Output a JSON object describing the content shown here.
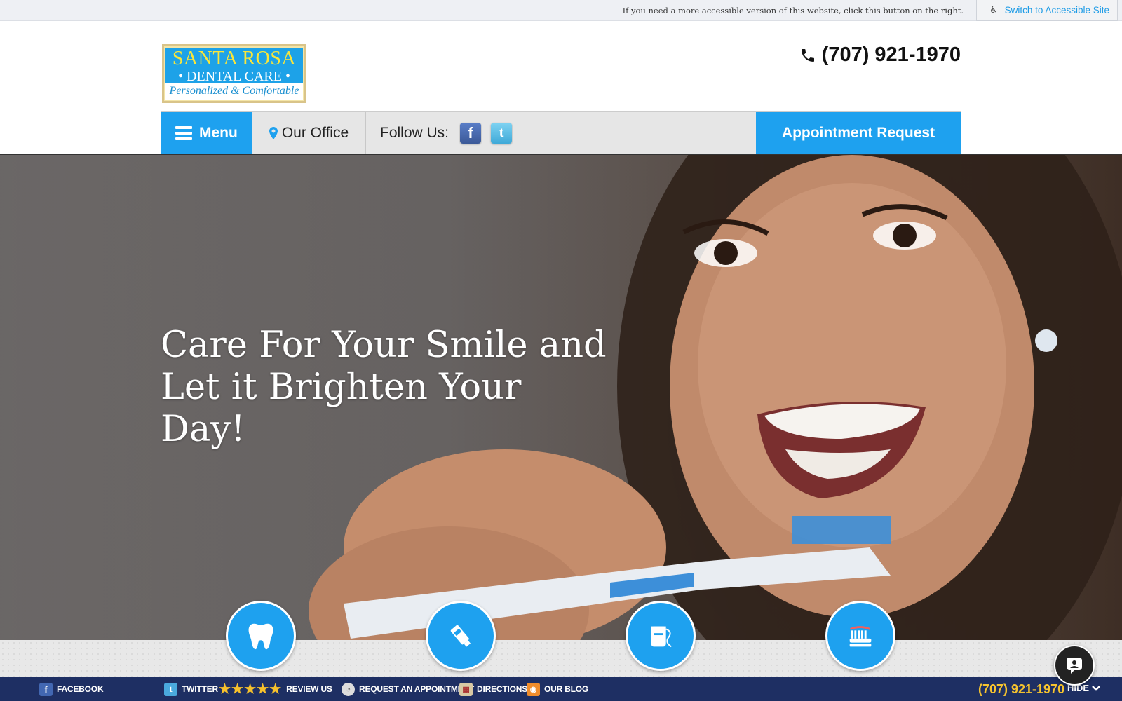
{
  "accessibility": {
    "message": "If you need a more accessible version of this website, click this button on the right.",
    "button_label": "Switch to Accessible Site",
    "icon": "wheelchair-icon"
  },
  "logo": {
    "line1": "SANTA ROSA",
    "line2": "• DENTAL CARE •",
    "tagline": "Personalized & Comfortable"
  },
  "header": {
    "phone": "(707) 921-1970"
  },
  "nav": {
    "menu_label": "Menu",
    "office_label": "Our Office",
    "follow_label": "Follow Us:",
    "social": [
      "facebook-icon",
      "twitter-icon"
    ],
    "appointment_label": "Appointment Request"
  },
  "hero": {
    "title_line1": "Care For Your Smile and",
    "title_line2": "Let it Brighten Your Day!"
  },
  "feature_icons": [
    "tooth-icon",
    "toothpaste-icon",
    "floss-icon",
    "toothbrush-icon"
  ],
  "bottom_bar": {
    "facebook": "FACEBOOK",
    "twitter": "TWITTER",
    "review": "REVIEW US",
    "rating_stars": 5,
    "appointment": "REQUEST AN APPOINTMENT",
    "directions": "DIRECTIONS",
    "blog": "OUR BLOG",
    "phone": "(707) 921-1970",
    "hide": "HIDE"
  },
  "colors": {
    "accent": "#1ea1ef",
    "bottom_bar": "#1e2f63",
    "phone_highlight": "#f6c32e",
    "logo_yellow": "#f9e63b"
  }
}
